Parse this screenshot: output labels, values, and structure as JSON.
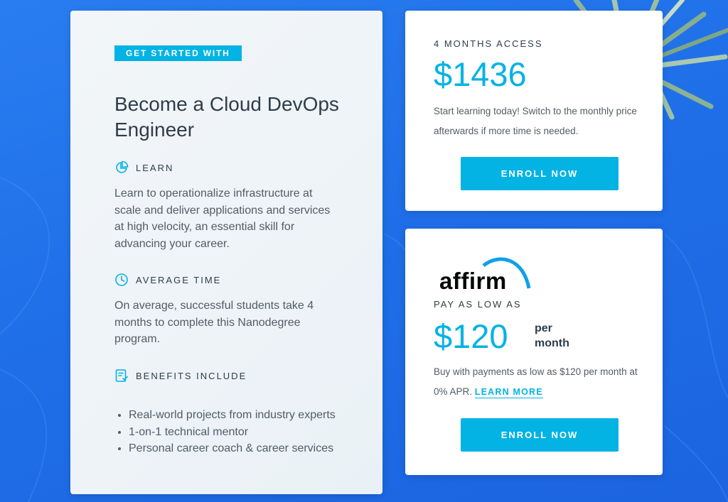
{
  "info": {
    "badge": "GET STARTED WITH",
    "title": "Become a Cloud DevOps Engineer",
    "learn": {
      "label": "LEARN",
      "text": "Learn to operationalize infrastructure at scale and deliver applications and services at high velocity, an essential skill for advancing your career."
    },
    "average_time": {
      "label": "AVERAGE TIME",
      "text": "On average, successful students take 4 months to complete this Nanodegree program."
    },
    "benefits": {
      "label": "BENEFITS INCLUDE",
      "items": [
        "Real-world projects from industry experts",
        "1-on-1 technical mentor",
        "Personal career coach & career services"
      ]
    }
  },
  "price_card": {
    "kicker": "4 MONTHS ACCESS",
    "price": "$1436",
    "description": "Start learning today! Switch to the monthly price afterwards if more time is needed.",
    "enroll_label": "ENROLL NOW"
  },
  "affirm_card": {
    "logo_text": "affirm",
    "kicker": "PAY AS LOW AS",
    "price": "$120",
    "per_month_line1": "per",
    "per_month_line2": "month",
    "description": "Buy with payments as low as $120 per month at 0% APR.",
    "learn_more_label": "LEARN MORE",
    "enroll_label": "ENROLL NOW"
  },
  "icons": {
    "learn": "pie-chart-icon",
    "average_time": "clock-icon",
    "benefits": "checklist-icon"
  },
  "colors": {
    "accent": "#02b3e4",
    "background": "#1f6fe8",
    "heading": "#2e3d49",
    "body_text": "#525c65"
  }
}
